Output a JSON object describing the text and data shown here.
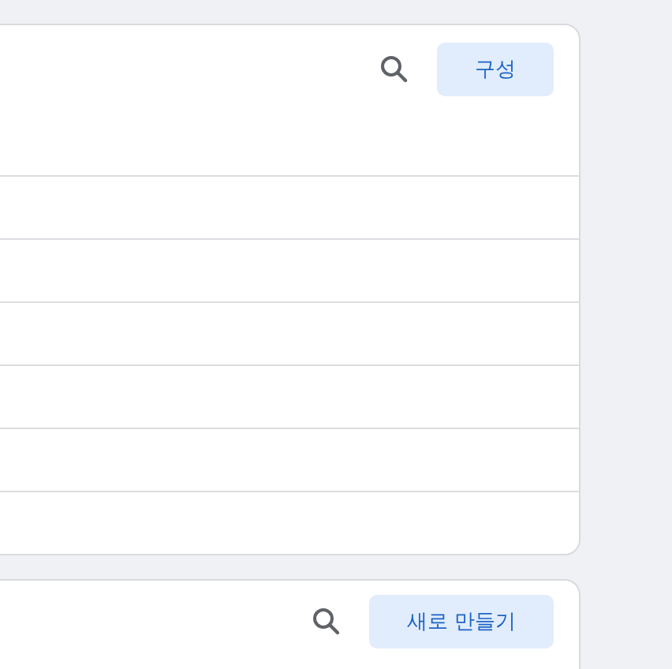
{
  "panels": [
    {
      "kind": "list",
      "button": "구성"
    },
    {
      "kind": "plain",
      "button": "새로 만들기"
    }
  ]
}
